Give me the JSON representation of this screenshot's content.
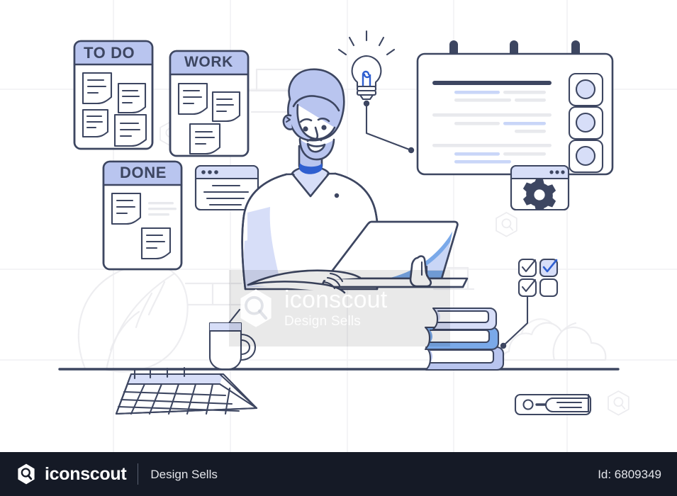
{
  "illustration": {
    "title": "Man working on laptop with task boards",
    "palette": {
      "stroke": "#3d4661",
      "periwinkle": "#b9c5ef",
      "periwinkle_light": "#d7def8",
      "blue_accent": "#7aa9e9",
      "blue_deep": "#2f5fd0",
      "grid": "#f0f0f2",
      "ghost": "#e9eaee",
      "white": "#ffffff",
      "footer_bg": "#151a26"
    }
  },
  "boards": [
    {
      "id": "todo",
      "label": "TO DO",
      "notes": 4
    },
    {
      "id": "work",
      "label": "WORK",
      "notes": 3
    },
    {
      "id": "done",
      "label": "DONE",
      "notes": 2
    }
  ],
  "checklist": {
    "items": [
      {
        "checked": true,
        "filled": false
      },
      {
        "checked": true,
        "filled": true
      },
      {
        "checked": true,
        "filled": false
      },
      {
        "checked": false,
        "filled": false
      }
    ]
  },
  "document_panel": {
    "rings": 3,
    "avatar_buttons": 3,
    "text_lines": 9
  },
  "gear_window": {
    "icon": "gear-icon",
    "dots": 3
  },
  "browser_window": {
    "dots": 3,
    "text_lines": 5
  },
  "idea_bulb": {
    "icon": "lightbulb-icon",
    "rays": 5
  },
  "desk_items": {
    "calendar": {
      "rows": 4,
      "cols": 7,
      "rings": 4
    },
    "mug": {
      "has_spoon": true
    },
    "books_stack": 3,
    "shelf_book": 1
  },
  "watermark": {
    "mark": "iconscout-logo-icon",
    "name": "iconscout",
    "tagline": "Design Sells"
  },
  "footer": {
    "mark": "iconscout-logo-icon",
    "brand": "iconscout",
    "tagline": "Design Sells",
    "asset_id": "Id: 6809349"
  }
}
